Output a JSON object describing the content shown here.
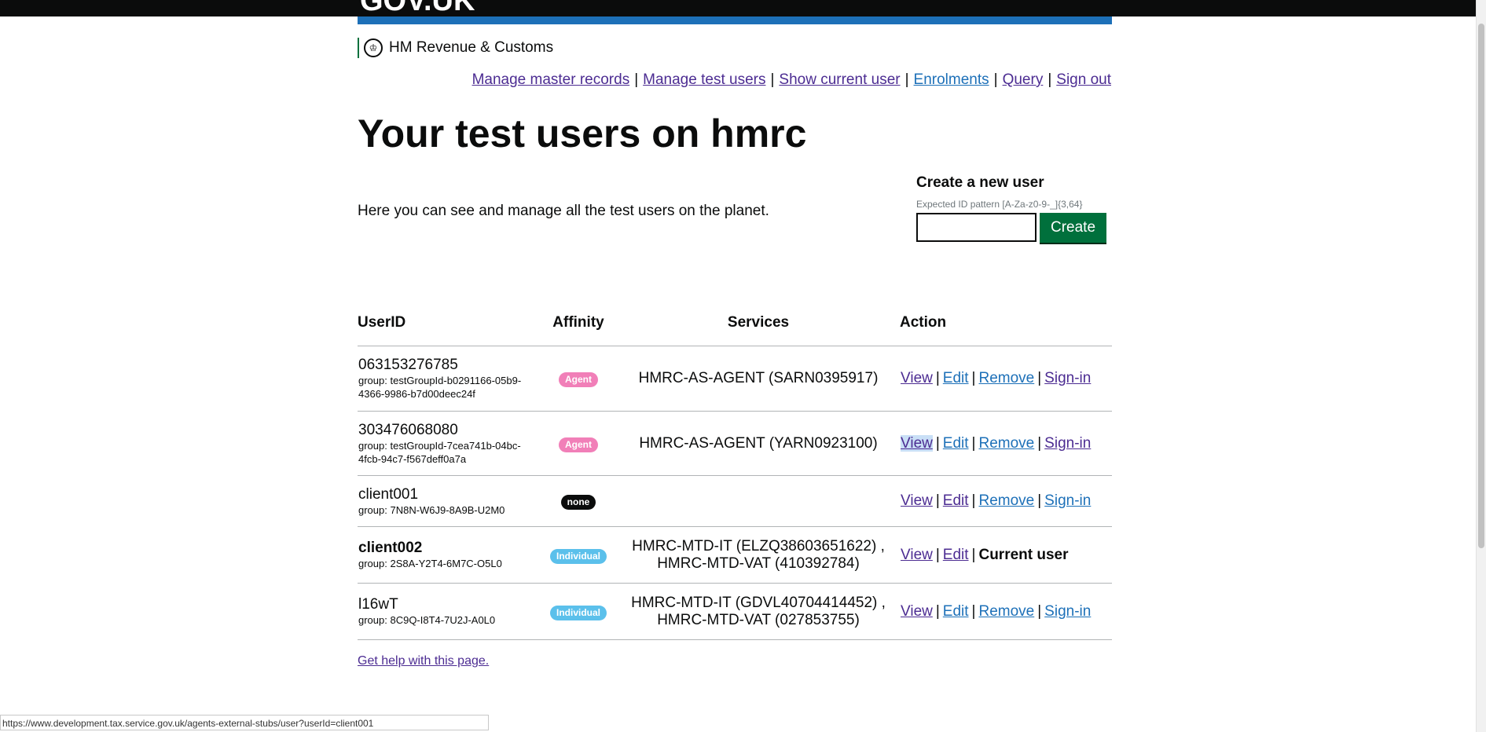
{
  "header": {
    "logo_text": "GOV.UK",
    "org_name": "HM Revenue & Customs",
    "crest_icon": "crown-icon"
  },
  "nav": {
    "items": [
      "Manage master records",
      "Manage test users",
      "Show current user",
      "Enrolments",
      "Query",
      "Sign out"
    ]
  },
  "page": {
    "title": "Your test users on hmrc",
    "intro": "Here you can see and manage all the test users on the planet."
  },
  "create": {
    "title": "Create a new user",
    "hint": "Expected ID pattern [A-Za-z0-9-_]{3,64}",
    "input_value": "",
    "button_label": "Create"
  },
  "table": {
    "headers": [
      "UserID",
      "Affinity",
      "Services",
      "Action"
    ],
    "rows": [
      {
        "user_id": "063153276785",
        "group": "group: testGroupId-b0291166-05b9-4366-9986-b7d00deec24f",
        "affinity": "Agent",
        "services": [
          "HMRC-AS-AGENT (SARN0395917)"
        ],
        "actions": [
          "View",
          "Edit",
          "Remove",
          "Sign-in"
        ]
      },
      {
        "user_id": "303476068080",
        "group": "group: testGroupId-7cea741b-04bc-4fcb-94c7-f567deff0a7a",
        "affinity": "Agent",
        "services": [
          "HMRC-AS-AGENT (YARN0923100)"
        ],
        "actions": [
          "View",
          "Edit",
          "Remove",
          "Sign-in"
        ]
      },
      {
        "user_id": "client001",
        "group": "group: 7N8N-W6J9-8A9B-U2M0",
        "affinity": "none",
        "services": [],
        "actions": [
          "View",
          "Edit",
          "Remove",
          "Sign-in"
        ]
      },
      {
        "user_id": "client002",
        "group": "group: 2S8A-Y2T4-6M7C-O5L0",
        "affinity": "Individual",
        "services": [
          "HMRC-MTD-IT (ELZQ38603651622) ,",
          "HMRC-MTD-VAT (410392784)"
        ],
        "actions": [
          "View",
          "Edit"
        ],
        "current_label": "Current user"
      },
      {
        "user_id": "l16wT",
        "group": "group: 8C9Q-I8T4-7U2J-A0L0",
        "affinity": "Individual",
        "services": [
          "HMRC-MTD-IT (GDVL40704414452) ,",
          "HMRC-MTD-VAT (027853755)"
        ],
        "actions": [
          "View",
          "Edit",
          "Remove",
          "Sign-in"
        ]
      }
    ]
  },
  "footer": {
    "help_link": "Get help with this page."
  },
  "status_bar": {
    "url": "https://www.development.tax.service.gov.uk/agents-external-stubs/user?userId=client001"
  }
}
